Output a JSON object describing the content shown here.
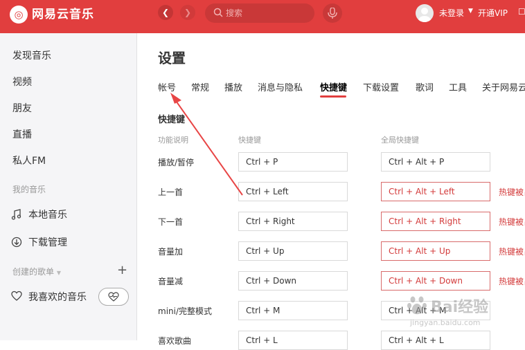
{
  "app": {
    "name": "网易云音乐"
  },
  "header": {
    "search_placeholder": "搜索",
    "user_login": "未登录",
    "vip": "开通VIP",
    "accent_color": "#e13e3e"
  },
  "sidebar": {
    "items": [
      "发现音乐",
      "视频",
      "朋友",
      "直播",
      "私人FM"
    ],
    "my_music_title": "我的音乐",
    "local_music": "本地音乐",
    "download_manage": "下载管理",
    "created_playlists_title": "创建的歌单",
    "liked_music": "我喜欢的音乐"
  },
  "settings": {
    "title": "设置",
    "tabs": [
      {
        "label": "帐号"
      },
      {
        "label": "常规"
      },
      {
        "label": "播放"
      },
      {
        "label": "消息与隐私"
      },
      {
        "label": "快捷键",
        "active": true
      },
      {
        "label": "下载设置"
      },
      {
        "label": "歌词"
      },
      {
        "label": "工具"
      },
      {
        "label": "关于网易云"
      }
    ],
    "shortcut_section": "快捷键",
    "columns": [
      "功能说明",
      "快捷键",
      "全局快捷键"
    ],
    "rows": [
      {
        "func": "播放/暂停",
        "key": "Ctrl + P",
        "global": "Ctrl + Alt + P",
        "conflict": false
      },
      {
        "func": "上一首",
        "key": "Ctrl + Left",
        "global": "Ctrl + Alt + Left",
        "conflict": true,
        "note": "热键被占"
      },
      {
        "func": "下一首",
        "key": "Ctrl + Right",
        "global": "Ctrl + Alt + Right",
        "conflict": true,
        "note": "热键被占"
      },
      {
        "func": "音量加",
        "key": "Ctrl + Up",
        "global": "Ctrl + Alt + Up",
        "conflict": true,
        "note": "热键被占"
      },
      {
        "func": "音量减",
        "key": "Ctrl + Down",
        "global": "Ctrl + Alt + Down",
        "conflict": true,
        "note": "热键被占"
      },
      {
        "func": "mini/完整模式",
        "key": "Ctrl + M",
        "global": "Ctrl + Alt + M",
        "conflict": false
      },
      {
        "func": "喜欢歌曲",
        "key": "Ctrl + L",
        "global": "Ctrl + Alt + L",
        "conflict": false
      }
    ]
  },
  "watermark": {
    "brand": "Bai经验",
    "url": "jingyan.baidu.com"
  }
}
